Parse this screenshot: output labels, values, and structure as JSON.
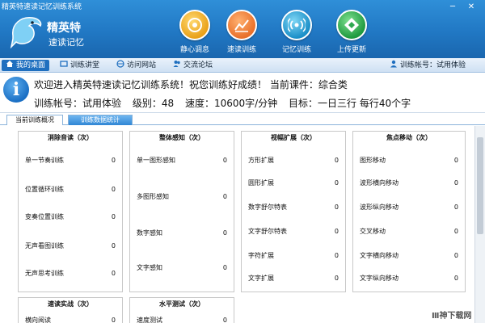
{
  "window": {
    "title": "精英特速读记忆训练系统",
    "minimize": "─",
    "close": "✕"
  },
  "brand": {
    "line1": "精英特",
    "line2": "速读记忆"
  },
  "nav": [
    {
      "label": "静心调息",
      "color": "#f0b429"
    },
    {
      "label": "速读训练",
      "color": "#f08a3a"
    },
    {
      "label": "记忆训练",
      "color": "#2aa7d9"
    },
    {
      "label": "上传更新",
      "color": "#2fa84f"
    }
  ],
  "toolbar": {
    "items": [
      "我的桌面",
      "训练讲堂",
      "访问网站",
      "交流论坛"
    ],
    "account": "训练帐号：试用体验"
  },
  "welcome": {
    "line1": "欢迎进入精英特速读记忆训练系统！祝您训练好成绩！  当前课件：综合类",
    "account": "训练帐号：试用体验",
    "level": "级别：48",
    "speed": "速度：10600字/分钟",
    "goal": "目标：一日三行  每行40个字"
  },
  "tabs": [
    "当前训练概况",
    "训练数据统计"
  ],
  "groups": [
    {
      "title": "消除音读（次）",
      "rows": [
        {
          "label": "单一节奏训练",
          "value": "0"
        },
        {
          "label": "位置循环训练",
          "value": "0"
        },
        {
          "label": "变奏位置训练",
          "value": "0"
        },
        {
          "label": "无声看图训练",
          "value": "0"
        },
        {
          "label": "无声思考训练",
          "value": "0"
        }
      ]
    },
    {
      "title": "整体感知（次）",
      "rows": [
        {
          "label": "单一图形感知",
          "value": "0"
        },
        {
          "label": "多图形感知",
          "value": "0"
        },
        {
          "label": "数字感知",
          "value": "0"
        },
        {
          "label": "文字感知",
          "value": "0"
        }
      ]
    },
    {
      "title": "视幅扩展（次）",
      "rows": [
        {
          "label": "方形扩展",
          "value": "0"
        },
        {
          "label": "圆形扩展",
          "value": "0"
        },
        {
          "label": "数字舒尔特表",
          "value": "0"
        },
        {
          "label": "文字舒尔特表",
          "value": "0"
        },
        {
          "label": "字符扩展",
          "value": "0"
        },
        {
          "label": "文字扩展",
          "value": "0"
        }
      ]
    },
    {
      "title": "焦点移动（次）",
      "rows": [
        {
          "label": "图形移动",
          "value": "0"
        },
        {
          "label": "波形横向移动",
          "value": "0"
        },
        {
          "label": "波形纵向移动",
          "value": "0"
        },
        {
          "label": "交叉移动",
          "value": "0"
        },
        {
          "label": "文字横向移动",
          "value": "0"
        },
        {
          "label": "文字纵向移动",
          "value": "0"
        }
      ]
    },
    {
      "title": "速读实战（次）",
      "rows": [
        {
          "label": "横向阅读",
          "value": "0"
        }
      ]
    },
    {
      "title": "水平测试（次）",
      "rows": [
        {
          "label": "速度测试",
          "value": "0"
        }
      ]
    }
  ],
  "watermark": "Ⅲ神下载网"
}
